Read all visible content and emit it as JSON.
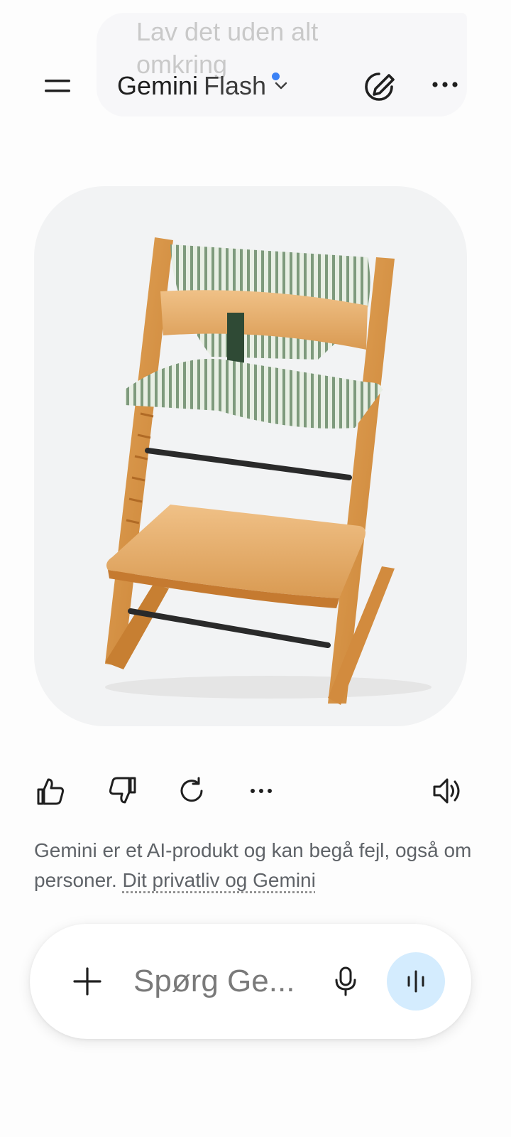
{
  "conversation": {
    "user_message": "Lav det uden alt omkring"
  },
  "header": {
    "model_name": "Gemini",
    "model_variant": "Flash",
    "icons": [
      "menu-icon",
      "chevron-down-icon",
      "edit-icon",
      "more-horizontal-icon"
    ]
  },
  "response": {
    "image_alt": "Generated image of a wooden high chair with striped green cushions",
    "actions": [
      "thumbs-up-icon",
      "thumbs-down-icon",
      "refresh-icon",
      "more-horizontal-icon",
      "speaker-icon"
    ]
  },
  "disclaimer": {
    "text": "Gemini er et AI-produkt og kan begå fejl, også om personer. ",
    "link": "Dit privatliv og Gemini"
  },
  "composer": {
    "placeholder": "Spørg Ge...",
    "icons": [
      "plus-icon",
      "microphone-icon",
      "live-audio-icon"
    ],
    "live_button_color": "#d4ecfe"
  },
  "colors": {
    "accent_dot": "#3b82f6",
    "background": "#fdfdfd",
    "card_background": "#f2f3f4"
  }
}
